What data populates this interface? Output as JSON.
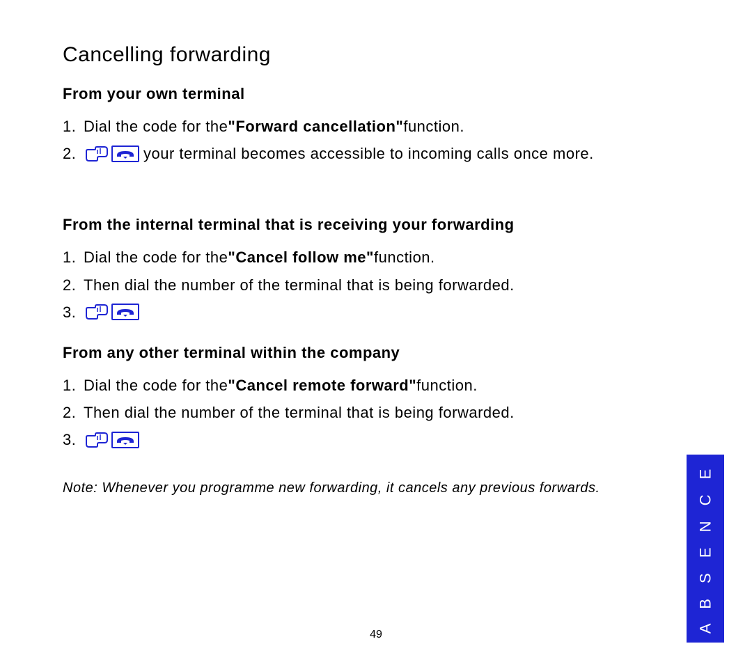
{
  "page": {
    "title": "Cancelling forwarding",
    "number": "49",
    "sideTab": "A B S E N C E"
  },
  "sections": [
    {
      "heading": "From your own terminal",
      "items": [
        {
          "num": "1.",
          "pre": "Dial the code for the ",
          "bold": "\"Forward cancellation\"",
          "post": " function."
        },
        {
          "num": "2.",
          "icons": true,
          "post": " your terminal becomes accessible to incoming calls once more."
        }
      ]
    },
    {
      "heading": "From the internal terminal that is receiving your forwarding",
      "items": [
        {
          "num": "1.",
          "pre": "Dial the code for the ",
          "bold": "\"Cancel follow me\"",
          "post": " function."
        },
        {
          "num": "2.",
          "pre": "Then dial the number of the terminal that is being forwarded."
        },
        {
          "num": "3.",
          "icons": true
        }
      ]
    },
    {
      "heading": "From any other terminal within the company",
      "items": [
        {
          "num": "1.",
          "pre": "Dial the code for the ",
          "bold": "\"Cancel remote forward\"",
          "post": " function."
        },
        {
          "num": "2.",
          "pre": "Then dial the number of the terminal that is being forwarded."
        },
        {
          "num": "3.",
          "icons": true
        }
      ]
    }
  ],
  "note": "Note: Whenever you programme new forwarding, it cancels any previous forwards."
}
